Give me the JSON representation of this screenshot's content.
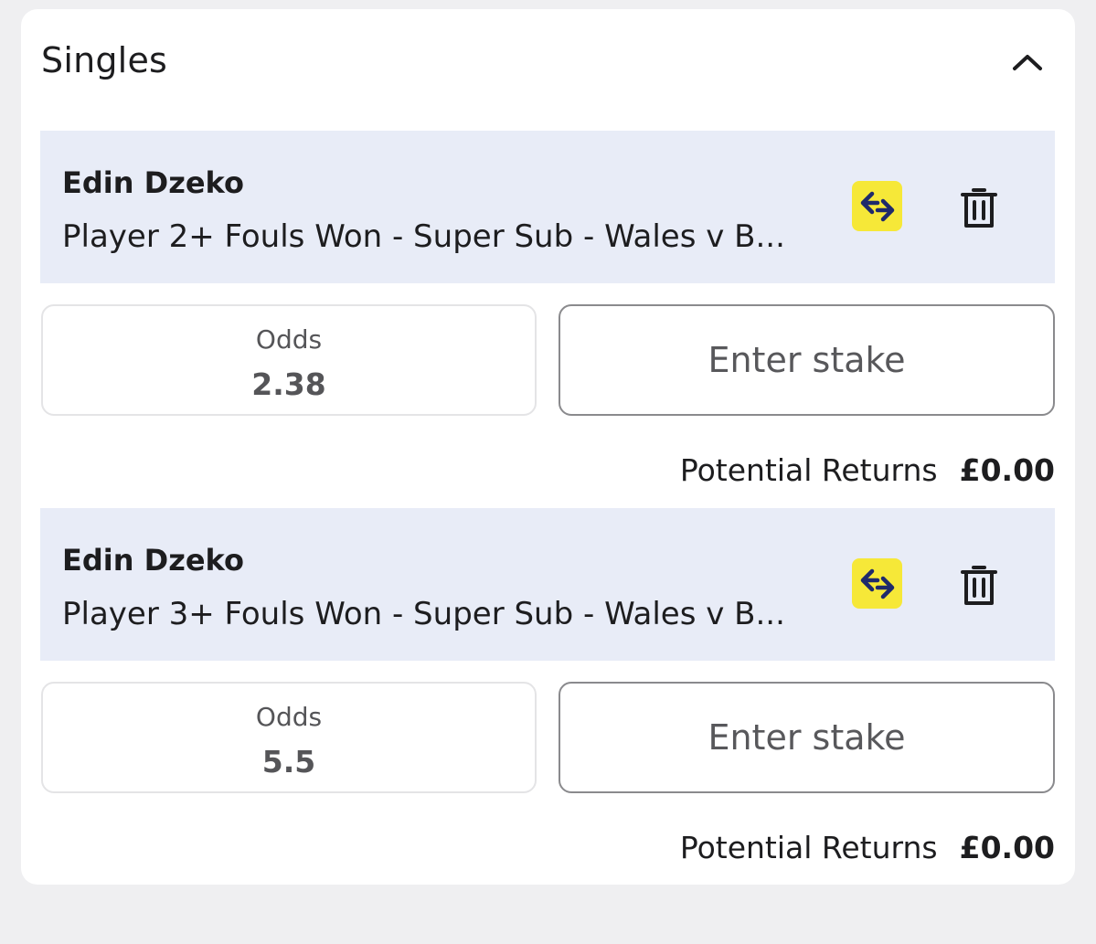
{
  "section": {
    "title": "Singles",
    "collapse_icon": "chevron-up-icon"
  },
  "bets": [
    {
      "player": "Edin Dzeko",
      "market": "Player 2+ Fouls Won - Super Sub - Wales v B...",
      "odds_label": "Odds",
      "odds": "2.38",
      "stake_placeholder": "Enter stake",
      "returns_label": "Potential Returns",
      "returns_value": "£0.00"
    },
    {
      "player": "Edin Dzeko",
      "market": "Player 3+ Fouls Won - Super Sub - Wales v B...",
      "odds_label": "Odds",
      "odds": "5.5",
      "stake_placeholder": "Enter stake",
      "returns_label": "Potential Returns",
      "returns_value": "£0.00"
    }
  ],
  "icons": {
    "swap": "swap-icon",
    "delete": "trash-icon"
  },
  "colors": {
    "selection_bg": "#e8ecf7",
    "swap_accent": "#f6e838",
    "swap_icon": "#1f2a6b",
    "page_bg": "#efeff1"
  }
}
